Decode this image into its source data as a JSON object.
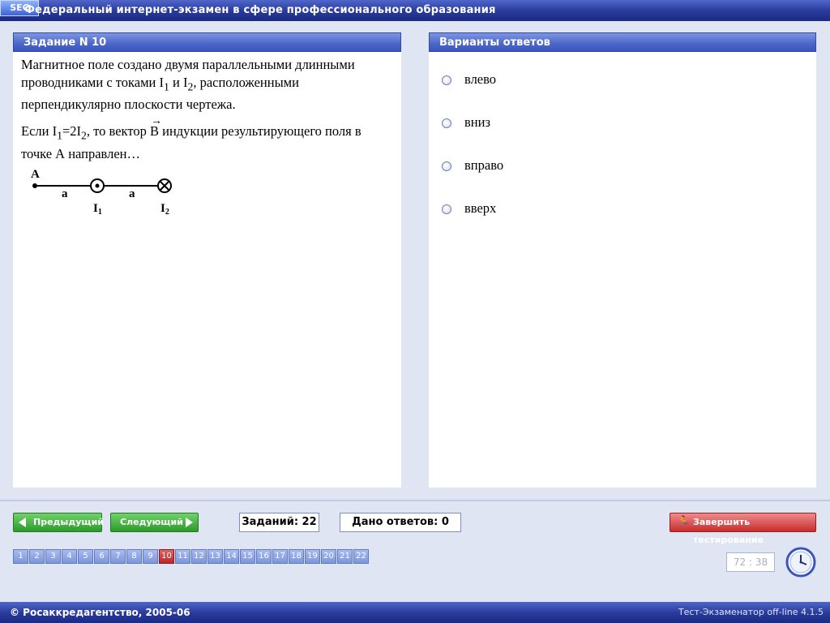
{
  "header": {
    "logo_text": "SEC",
    "title": "Федеральный интернет-экзамен в сфере профессионального образования"
  },
  "question": {
    "panel_title": "Задание N 10",
    "line1": "Магнитное поле создано двумя параллельными длинными проводниками с токами I",
    "line1_sub1": "1",
    "line1_mid": " и I",
    "line1_sub2": "2",
    "line1_end": ", расположенными перпендикулярно плоскости чертежа.",
    "line2_a": "Если I",
    "line2_sub1": "1",
    "line2_b": "=2I",
    "line2_sub2": "2",
    "line2_c": ", то вектор ",
    "vector_symbol": "B",
    "line2_d": " индукции результирующего поля в точке А направлен…",
    "figure": {
      "point_label": "A",
      "dist_label_1": "a",
      "dist_label_2": "a",
      "wire1_label": "I",
      "wire1_sub": "1",
      "wire2_label": "I",
      "wire2_sub": "2"
    }
  },
  "answers": {
    "panel_title": "Варианты ответов",
    "options": [
      "влево",
      "вниз",
      "вправо",
      "вверх"
    ]
  },
  "nav": {
    "prev_label": "Предыдущий",
    "next_label": "Следующий",
    "total_tasks": "Заданий: 22",
    "answered": "Дано ответов: 0",
    "finish_label": "Завершить тестирование",
    "current": 10,
    "questions": [
      "1",
      "2",
      "3",
      "4",
      "5",
      "6",
      "7",
      "8",
      "9",
      "10",
      "11",
      "12",
      "13",
      "14",
      "15",
      "16",
      "17",
      "18",
      "19",
      "20",
      "21",
      "22"
    ]
  },
  "timer": {
    "value": "72 : 38"
  },
  "footer": {
    "copyright": "© Росаккредагентство, 2005-06",
    "version": "Тест-Экзаменатор off-line 4.1.5"
  }
}
